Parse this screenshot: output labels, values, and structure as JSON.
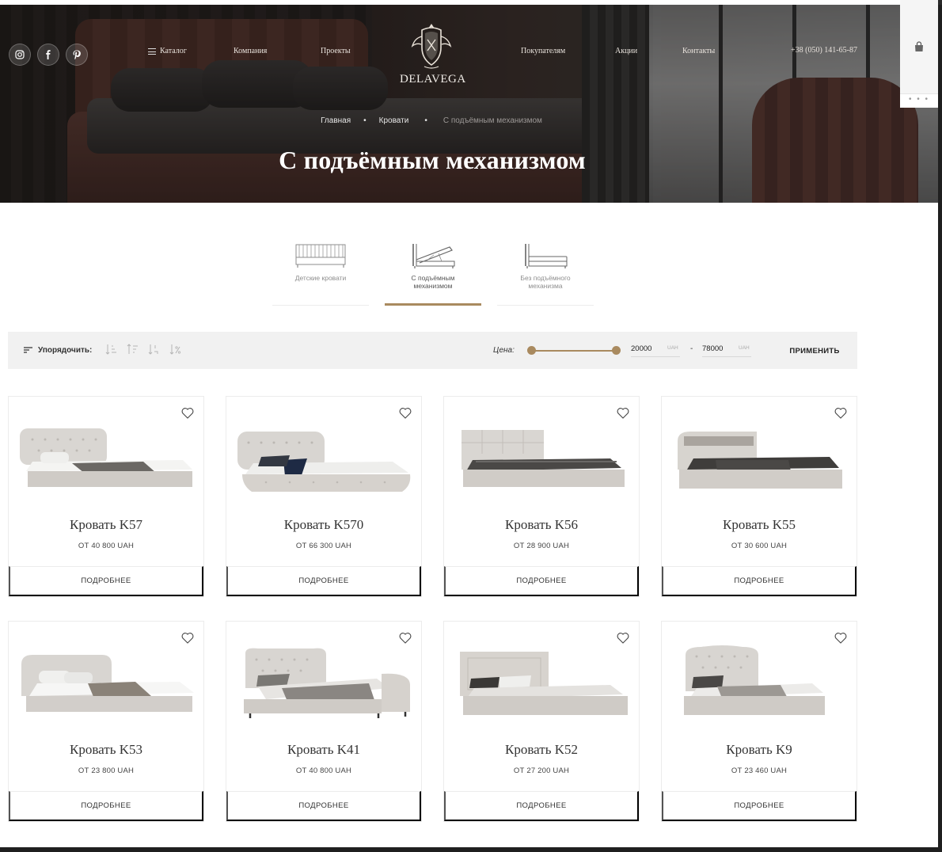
{
  "header": {
    "logo_text": "DELAVEGA",
    "nav": {
      "catalog": "Каталог",
      "company": "Компания",
      "projects": "Проекты",
      "buyers": "Покупателям",
      "promotions": "Акции",
      "contacts": "Контакты"
    },
    "phone": "+38 (050) 141-65-87",
    "more_dots": "• • •"
  },
  "breadcrumb": {
    "home": "Главная",
    "beds": "Кровати",
    "current": "С подъёмным механизмом",
    "separator": "•"
  },
  "page_title": "С подъёмным механизмом",
  "categories": [
    {
      "label": "Детские кровати",
      "active": false
    },
    {
      "label": "С подъёмным механизмом",
      "active": true
    },
    {
      "label": "Без подъёмного механизма",
      "active": false
    }
  ],
  "filter": {
    "sort_label": "Упорядочить:",
    "price_label": "Цена:",
    "min_price": "20000",
    "max_price": "78000",
    "currency": "UAH",
    "dash": "-",
    "apply_label": "ПРИМЕНИТЬ",
    "accent_color": "#a98a5f"
  },
  "products": [
    {
      "name": "Кровать K57",
      "price": "ОТ 40 800 UAH",
      "button": "ПОДРОБНЕЕ"
    },
    {
      "name": "Кровать K570",
      "price": "ОТ 66 300 UAH",
      "button": "ПОДРОБНЕЕ"
    },
    {
      "name": "Кровать K56",
      "price": "ОТ 28 900 UAH",
      "button": "ПОДРОБНЕЕ"
    },
    {
      "name": "Кровать K55",
      "price": "ОТ 30 600 UAH",
      "button": "ПОДРОБНЕЕ"
    },
    {
      "name": "Кровать K53",
      "price": "ОТ 23 800 UAH",
      "button": "ПОДРОБНЕЕ"
    },
    {
      "name": "Кровать K41",
      "price": "ОТ 40 800 UAH",
      "button": "ПОДРОБНЕЕ"
    },
    {
      "name": "Кровать K52",
      "price": "ОТ 27 200 UAH",
      "button": "ПОДРОБНЕЕ"
    },
    {
      "name": "Кровать K9",
      "price": "ОТ 23 460 UAH",
      "button": "ПОДРОБНЕЕ"
    }
  ]
}
